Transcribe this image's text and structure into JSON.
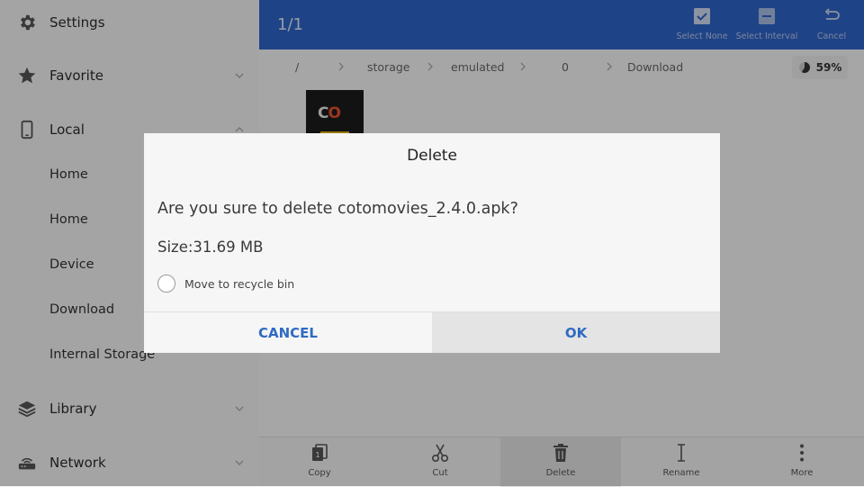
{
  "sidebar": {
    "items": [
      {
        "label": "Settings"
      },
      {
        "label": "Favorite"
      },
      {
        "label": "Local"
      },
      {
        "label": "Home"
      },
      {
        "label": "Home"
      },
      {
        "label": "Device"
      },
      {
        "label": "Download"
      },
      {
        "label": "Internal Storage"
      },
      {
        "label": "Library"
      },
      {
        "label": "Network"
      }
    ]
  },
  "topbar": {
    "count": "1/1",
    "select_none": "Select None",
    "select_interval": "Select Interval",
    "cancel": "Cancel",
    "color": "#2f63c7"
  },
  "breadcrumb": [
    "/",
    "storage",
    "emulated",
    "0",
    "Download"
  ],
  "storage": {
    "percent_label": "59%",
    "used_fraction": 0.59
  },
  "file": {
    "thumb_text": "CO"
  },
  "bottombar": {
    "copy": "Copy",
    "cut": "Cut",
    "delete": "Delete",
    "rename": "Rename",
    "more": "More"
  },
  "dialog": {
    "title": "Delete",
    "message": "Are you sure to delete cotomovies_2.4.0.apk?",
    "size": "Size:31.69 MB",
    "recycle_label": "Move to recycle bin",
    "recycle_checked": false,
    "cancel_label": "CANCEL",
    "ok_label": "OK",
    "button_color": "#2f6bc2"
  }
}
